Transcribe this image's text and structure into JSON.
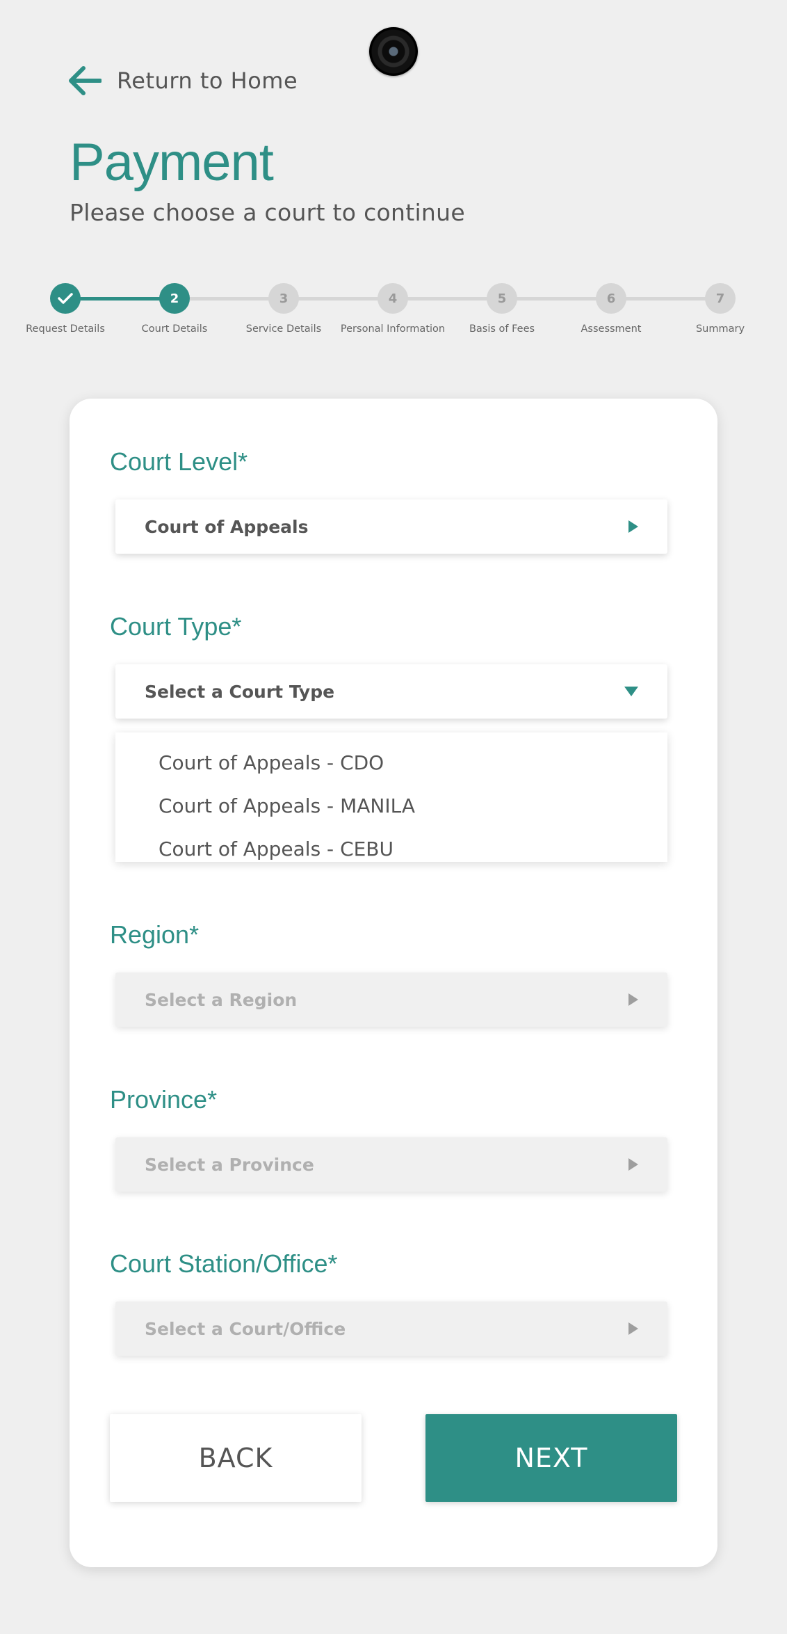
{
  "header": {
    "return_label": "Return to Home",
    "title": "Payment",
    "subtitle": "Please choose a court to continue"
  },
  "stepper": {
    "current_step": 2,
    "steps": [
      {
        "number": "1",
        "label": "Request Details",
        "status": "done"
      },
      {
        "number": "2",
        "label": "Court Details",
        "status": "active"
      },
      {
        "number": "3",
        "label": "Service Details",
        "status": "pending"
      },
      {
        "number": "4",
        "label": "Personal Information",
        "status": "pending"
      },
      {
        "number": "5",
        "label": "Basis of Fees",
        "status": "pending"
      },
      {
        "number": "6",
        "label": "Assessment",
        "status": "pending"
      },
      {
        "number": "7",
        "label": "Summary",
        "status": "pending"
      }
    ]
  },
  "form": {
    "court_level": {
      "label": "Court Level*",
      "value": "Court of Appeals"
    },
    "court_type": {
      "label": "Court Type*",
      "placeholder": "Select a Court Type",
      "options": [
        "Court of Appeals - CDO",
        "Court of Appeals - MANILA",
        "Court of Appeals - CEBU"
      ]
    },
    "region": {
      "label": "Region*",
      "placeholder": "Select a Region"
    },
    "province": {
      "label": "Province*",
      "placeholder": "Select a Province"
    },
    "court_station": {
      "label": "Court Station/Office*",
      "placeholder": "Select a Court/Office"
    }
  },
  "actions": {
    "back_label": "BACK",
    "next_label": "NEXT"
  },
  "colors": {
    "accent": "#2e8f86",
    "background": "#efefef",
    "inactive": "#d6d6d6"
  },
  "icons": {
    "return": "arrow-left-icon",
    "step_done": "checkmark-icon",
    "select_closed": "caret-right-icon",
    "select_open": "caret-down-icon"
  }
}
